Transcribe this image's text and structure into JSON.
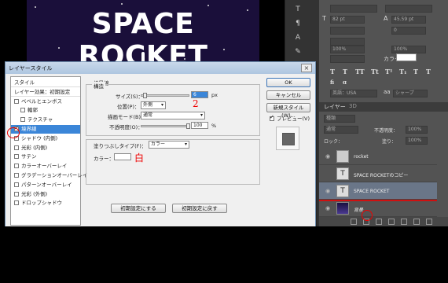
{
  "canvas": {
    "title": "SPACE ROCKET"
  },
  "dialog": {
    "title": "レイヤースタイル",
    "close": "×",
    "style_list": [
      {
        "label": "スタイル",
        "kind": "hdr"
      },
      {
        "label": "レイヤー効果：初期設定",
        "kind": "hdr"
      },
      {
        "label": "ベベルとエンボス",
        "checked": false
      },
      {
        "label": "輪郭",
        "checked": false,
        "indent": true
      },
      {
        "label": "テクスチャ",
        "checked": false,
        "indent": true
      },
      {
        "label": "境界線",
        "checked": true,
        "selected": true
      },
      {
        "label": "シャドウ (内側)",
        "checked": false
      },
      {
        "label": "光彩 (内側)",
        "checked": false
      },
      {
        "label": "サテン",
        "checked": false
      },
      {
        "label": "カラーオーバーレイ",
        "checked": false
      },
      {
        "label": "グラデーションオーバーレイ",
        "checked": false
      },
      {
        "label": "パターンオーバーレイ",
        "checked": false
      },
      {
        "label": "光彩 (外側)",
        "checked": false
      },
      {
        "label": "ドロップシャドウ",
        "checked": false
      }
    ],
    "section_title": "境界線",
    "group_structure": "構造",
    "size_label": "サイズ(S)：",
    "size_value": "6",
    "size_unit": "px",
    "position_label": "位置(P)：",
    "position_value": "外側",
    "blend_label": "描画モード(B)：",
    "blend_value": "通常",
    "opacity_label": "不透明度(O)：",
    "opacity_value": "100",
    "opacity_unit": "%",
    "opacity_level": 1.0,
    "size_level": 0.04,
    "fill_type_label": "塗りつぶしタイプ(F)：",
    "fill_type_value": "カラー",
    "color_label": "カラー：",
    "annotation_2": "2",
    "annotation_white": "白",
    "btn_make_default": "初期設定にする",
    "btn_reset_default": "初期設定に戻す",
    "btn_ok": "OK",
    "btn_cancel": "キャンセル",
    "btn_new_style": "新規スタイル(W)...",
    "preview_label": "プレビュー(V)",
    "preview_checked": true
  },
  "char_panel": {
    "font_size": "82 pt",
    "leading": "45.59 pt",
    "tracking": "0",
    "scale_v": "100%",
    "scale_h": "100%",
    "color_label": "カラー：",
    "antialias": "シャープ",
    "lang": "英語：USA",
    "aa_label": "aa"
  },
  "layers_panel": {
    "tab_layers": "レイヤー",
    "tab_3d": "3D",
    "kind_label": "種類",
    "blend": "通常",
    "opacity_label": "不透明度：",
    "opacity": "100%",
    "lock_label": "ロック：",
    "fill_label": "塗り：",
    "fill": "100%",
    "layers": [
      {
        "name": "rocket",
        "visible": true,
        "selected": false
      },
      {
        "name": "SPACE ROCKETのコピー",
        "visible": false,
        "selected": false
      },
      {
        "name": "SPACE ROCKET",
        "visible": true,
        "selected": true
      },
      {
        "name": "背景",
        "visible": true,
        "selected": false
      }
    ]
  }
}
